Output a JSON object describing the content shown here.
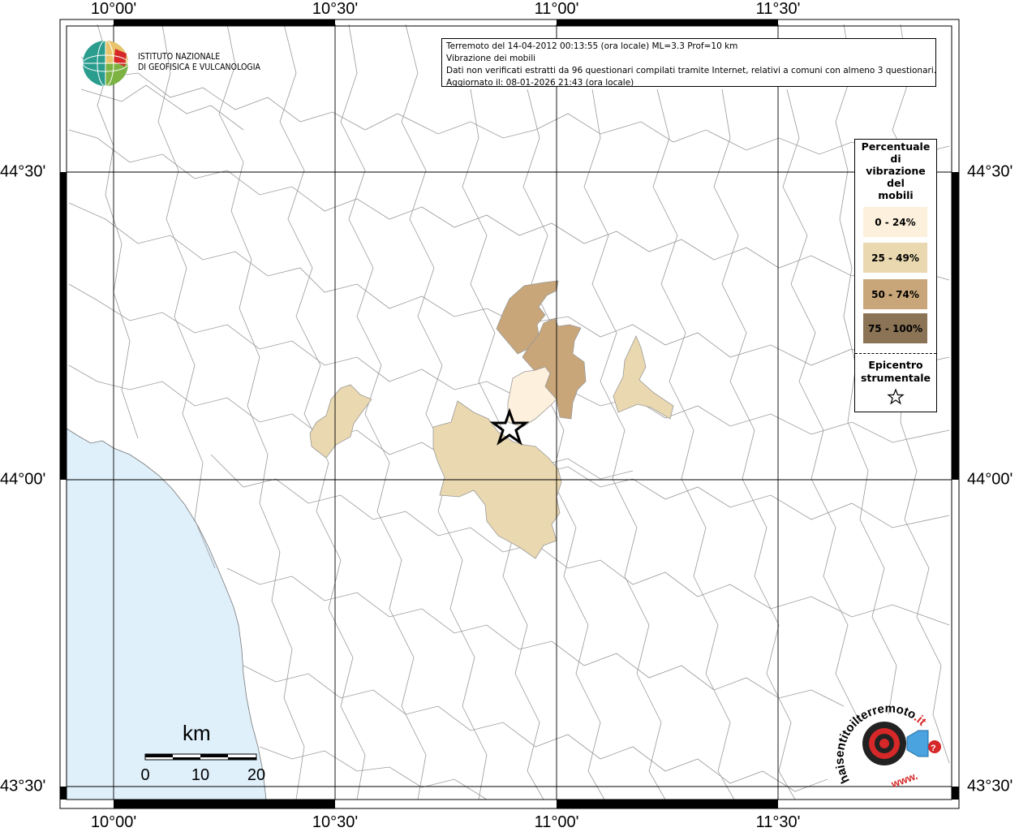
{
  "axes": {
    "longitude_labels": [
      "10°00'",
      "10°30'",
      "11°00'",
      "11°30'"
    ],
    "latitude_labels": [
      "44°30'",
      "44°00'",
      "43°30'"
    ]
  },
  "institute": {
    "line1": "ISTITUTO NAZIONALE",
    "line2": "DI GEOFISICA E VULCANOLOGIA"
  },
  "info": {
    "line1": "Terremoto del 14-04-2012 00:13:55 (ora locale) ML=3.3 Prof=10 km",
    "line2": "Vibrazione dei mobili",
    "line3": "Dati non verificati estratti da 96 questionari compilati tramite Internet, relativi a comuni con almeno 3 questionari.",
    "line4": "Aggiornato il: 08-01-2026 21:43 (ora locale)"
  },
  "legend": {
    "title_lines": [
      "Percentuale",
      "di",
      "vibrazione",
      "del",
      "mobili"
    ],
    "classes": [
      {
        "label": "0 - 24%",
        "color": "#fdf0dc"
      },
      {
        "label": "25 - 49%",
        "color": "#ead8b0"
      },
      {
        "label": "50 - 74%",
        "color": "#c8a679"
      },
      {
        "label": "75 - 100%",
        "color": "#8b7355"
      }
    ],
    "epicenter_lines": [
      "Epicentro",
      "strumentale"
    ]
  },
  "scale_bar": {
    "unit": "km",
    "labels": [
      "0",
      "10",
      "20"
    ]
  },
  "watermark": {
    "text_main": "haisentitoilterremoto",
    "text_suffix": ".it",
    "text_www": "www."
  },
  "colors": {
    "sea": "#dff0fb",
    "border": "#999999",
    "grid": "#000000"
  }
}
